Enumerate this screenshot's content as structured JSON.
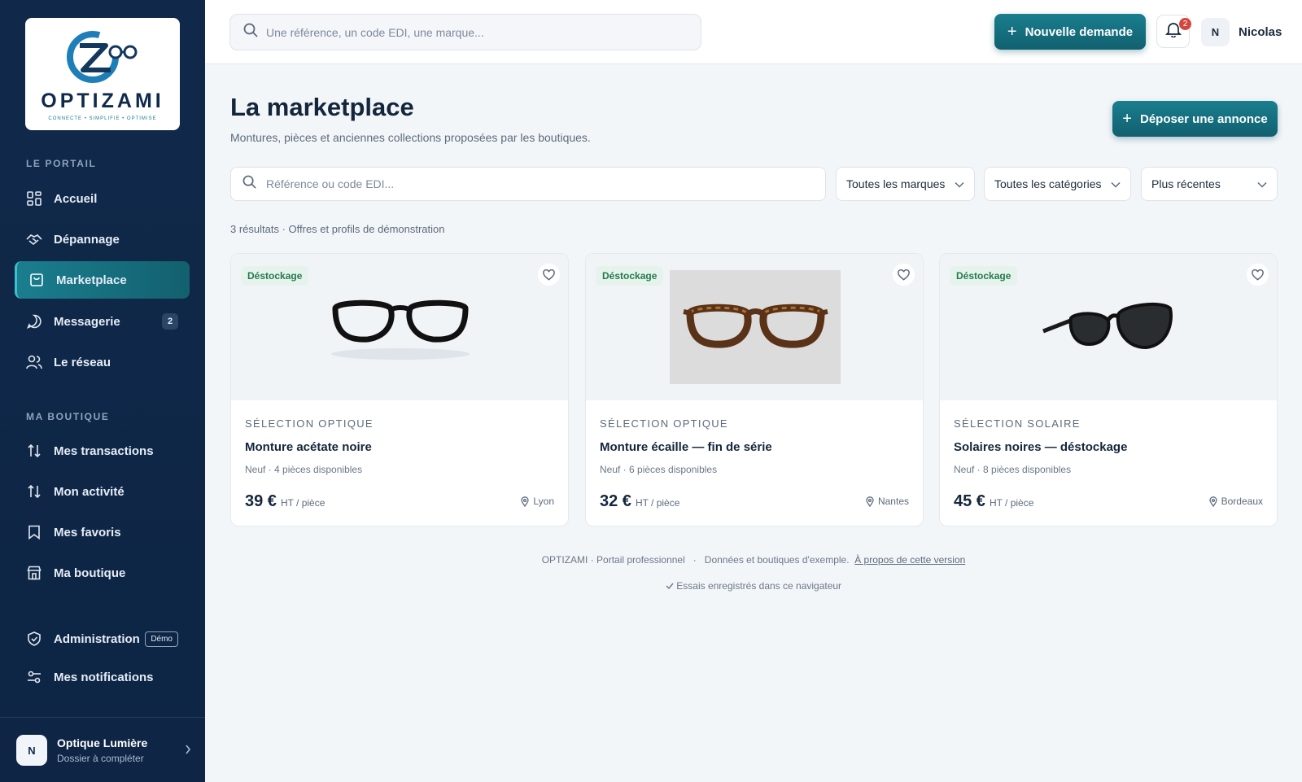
{
  "brand": {
    "name": "OPTIZAMI",
    "tagline": "CONNECTE • SIMPLIFIE • OPTIMISE"
  },
  "sidebar": {
    "portal_label": "LE PORTAIL",
    "portal_items": [
      {
        "label": "Accueil",
        "icon": "grid-icon"
      },
      {
        "label": "Dépannage",
        "icon": "handshake-icon"
      },
      {
        "label": "Marketplace",
        "icon": "bag-icon",
        "active": true
      },
      {
        "label": "Messagerie",
        "icon": "chat-icon",
        "badge": "2"
      },
      {
        "label": "Le réseau",
        "icon": "users-icon"
      }
    ],
    "shop_label": "MA BOUTIQUE",
    "shop_items": [
      {
        "label": "Mes transactions",
        "icon": "arrows-icon"
      },
      {
        "label": "Mon activité",
        "icon": "arrows-icon"
      },
      {
        "label": "Mes favoris",
        "icon": "bookmark-icon"
      },
      {
        "label": "Ma boutique",
        "icon": "store-icon"
      }
    ],
    "admin": {
      "label": "Administration",
      "badge": "Démo"
    },
    "notifications": {
      "label": "Mes notifications"
    },
    "profile": {
      "initial": "N",
      "name": "Optique Lumière",
      "status": "Dossier à compléter"
    }
  },
  "topbar": {
    "search_placeholder": "Une référence, un code EDI, une marque...",
    "new_request": "Nouvelle demande",
    "notif_count": "2",
    "user_initial": "N",
    "user_name": "Nicolas"
  },
  "main": {
    "title": "La marketplace",
    "subtitle": "Montures, pièces et anciennes collections proposées par les boutiques.",
    "cta": "Déposer une annonce",
    "filter_placeholder": "Référence ou code EDI...",
    "brand_select": "Toutes les marques",
    "category_select": "Toutes les catégories",
    "sort_select": "Plus récentes",
    "results": "3 résultats · Offres et profils de démonstration",
    "cards": [
      {
        "tag": "Déstockage",
        "category": "SÉLECTION OPTIQUE",
        "title": "Monture acétate noire",
        "meta": "Neuf · 4 pièces disponibles",
        "price": "39 €",
        "unit": "HT / pièce",
        "location": "Lyon"
      },
      {
        "tag": "Déstockage",
        "category": "SÉLECTION OPTIQUE",
        "title": "Monture écaille — fin de série",
        "meta": "Neuf · 6 pièces disponibles",
        "price": "32 €",
        "unit": "HT / pièce",
        "location": "Nantes"
      },
      {
        "tag": "Déstockage",
        "category": "SÉLECTION SOLAIRE",
        "title": "Solaires noires — déstockage",
        "meta": "Neuf · 8 pièces disponibles",
        "price": "45 €",
        "unit": "HT / pièce",
        "location": "Bordeaux"
      }
    ]
  },
  "footer": {
    "left": "OPTIZAMI · Portail professionnel",
    "sep": "·",
    "middle": "Données et boutiques d'exemple.",
    "link": "À propos de cette version",
    "saved": "Essais enregistrés dans ce navigateur"
  },
  "colors": {
    "accent": "#1a7e8e",
    "sidebar": "#10294a",
    "danger": "#d6453d",
    "tag_bg": "#e6f3ec"
  }
}
